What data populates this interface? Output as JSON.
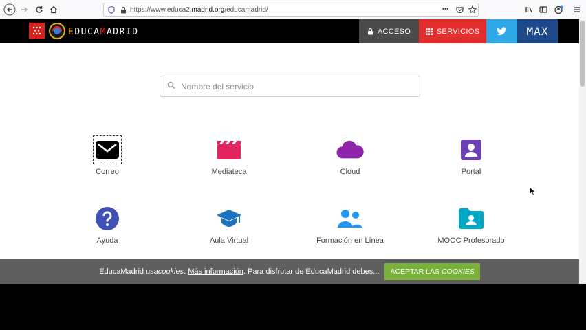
{
  "browser": {
    "url_prefix": "https://www.educa2.",
    "url_domain": "madrid.org",
    "url_path": "/educamadrid/",
    "more_label": "•••"
  },
  "header": {
    "brand_e": "E",
    "brand_duca": "DUCA",
    "brand_m": "M",
    "brand_adrid": "ADRID",
    "acceso_label": "ACCESO",
    "servicios_label": "SERVICIOS",
    "max_label": "MAX"
  },
  "search": {
    "placeholder": "Nombre del servicio"
  },
  "services": [
    {
      "label": "Correo",
      "color": "#000000",
      "icon": "envelope-icon"
    },
    {
      "label": "Mediateca",
      "color": "#e4245e",
      "icon": "clapperboard-icon"
    },
    {
      "label": "Cloud",
      "color": "#8e24aa",
      "icon": "cloud-icon"
    },
    {
      "label": "Portal",
      "color": "#6c3fb5",
      "icon": "portrait-icon"
    },
    {
      "label": "Ayuda",
      "color": "#3f51b5",
      "icon": "question-icon"
    },
    {
      "label": "Aula Virtual",
      "color": "#1e73be",
      "icon": "graduation-cap-icon"
    },
    {
      "label": "Formación en Línea",
      "color": "#2196f3",
      "icon": "users-icon"
    },
    {
      "label": "MOOC Profesorado",
      "color": "#00a8c6",
      "icon": "folder-user-icon"
    }
  ],
  "cookie": {
    "text_1": "EducaMadrid usa ",
    "text_cookies": "cookies",
    "text_2": ". ",
    "link": "Más información",
    "text_3": ". Para disfrutar de EducaMadrid debes...",
    "accept_1": "ACEPTAR LAS ",
    "accept_2": "COOKIES"
  }
}
